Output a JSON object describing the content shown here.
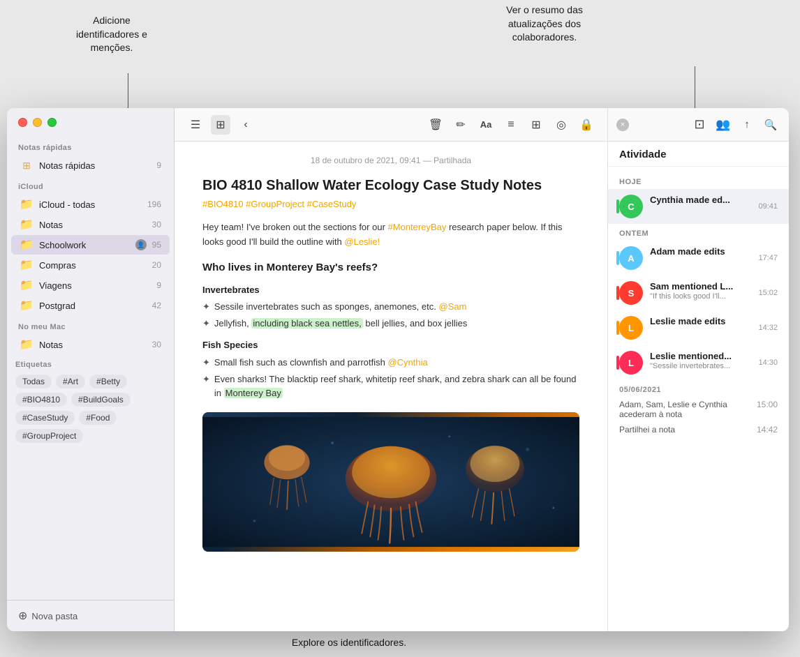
{
  "annotations": {
    "top_left": "Adicione\nidentificadores e\nmenções.",
    "top_right": "Ver o resumo das\natualizações dos\ncolaboradores.",
    "bottom_center": "Explore os identificadores."
  },
  "sidebar": {
    "sections": [
      {
        "label": "Notas rápidas",
        "items": [
          {
            "id": "quick-notes",
            "name": "Notas rápidas",
            "icon": "grid",
            "badge": "9"
          }
        ]
      },
      {
        "label": "iCloud",
        "items": [
          {
            "id": "icloud-all",
            "name": "iCloud - todas",
            "icon": "folder",
            "badge": "196"
          },
          {
            "id": "notas",
            "name": "Notas",
            "icon": "folder",
            "badge": "30"
          },
          {
            "id": "schoolwork",
            "name": "Schoolwork",
            "icon": "folder",
            "badge": "95",
            "active": true,
            "shared": true
          },
          {
            "id": "compras",
            "name": "Compras",
            "icon": "folder",
            "badge": "20"
          },
          {
            "id": "viagens",
            "name": "Viagens",
            "icon": "folder",
            "badge": "9"
          },
          {
            "id": "postgrad",
            "name": "Postgrad",
            "icon": "folder",
            "badge": "42"
          }
        ]
      },
      {
        "label": "No meu Mac",
        "items": [
          {
            "id": "notas-mac",
            "name": "Notas",
            "icon": "folder",
            "badge": "30"
          }
        ]
      }
    ],
    "tags": {
      "label": "Etiquetas",
      "items": [
        "Todas",
        "#Art",
        "#Betty",
        "#BIO4810",
        "#BuildGoals",
        "#CaseStudy",
        "#Food",
        "#GroupProject"
      ]
    },
    "footer": {
      "new_folder_label": "Nova pasta"
    }
  },
  "toolbar": {
    "icons": [
      "list",
      "grid",
      "back",
      "delete",
      "edit",
      "font",
      "list-format",
      "table",
      "media",
      "lock"
    ]
  },
  "note": {
    "meta": "18 de outubro de 2021, 09:41 — Partilhada",
    "title": "BIO 4810 Shallow Water Ecology Case Study Notes",
    "hashtags": "#BIO4810 #GroupProject #CaseStudy",
    "intro": "Hey team! I've broken out the sections for our #MontereyBay research paper below. If this looks good I'll build the outline with @Leslie!",
    "section1_heading": "Who lives in Monterey Bay's reefs?",
    "section2_heading": "Invertebrates",
    "invertebrates": [
      "Sessile invertebrates such as sponges, anemones, etc. @Sam",
      "Jellyfish, including black sea nettles, bell jellies, and box jellies"
    ],
    "section3_heading": "Fish Species",
    "fish": [
      "Small fish such as clownfish and parrotfish @Cynthia",
      "Even sharks! The blacktip reef shark, whitetip reef shark, and zebra shark can all be found in Monterey Bay"
    ]
  },
  "activity": {
    "panel_title": "Atividade",
    "close_btn": "×",
    "today_label": "HOJE",
    "yesterday_label": "ONTEM",
    "older_label": "05/06/2021",
    "items_today": [
      {
        "id": "cynthia-edit",
        "name": "Cynthia made ed...",
        "avatar_color": "#34c759",
        "avatar_initials": "C",
        "time": "09:41",
        "accent": "#34c759"
      }
    ],
    "items_yesterday": [
      {
        "id": "adam-edit",
        "name": "Adam made edits",
        "avatar_color": "#5ac8fa",
        "avatar_initials": "A",
        "time": "17:47",
        "accent": "#5ac8fa"
      },
      {
        "id": "sam-mention",
        "name": "Sam mentioned L...",
        "avatar_color": "#ff3b30",
        "avatar_initials": "S",
        "time": "15:02",
        "preview": "\"If this looks good I'll...",
        "accent": "#ff3b30"
      },
      {
        "id": "leslie-edit",
        "name": "Leslie made edits",
        "avatar_color": "#ff9500",
        "avatar_initials": "L",
        "time": "14:32",
        "accent": "#ff9500"
      },
      {
        "id": "leslie-mention",
        "name": "Leslie mentioned...",
        "avatar_color": "#ff2d55",
        "avatar_initials": "L",
        "time": "14:30",
        "preview": "\"Sessile invertebrates...",
        "accent": "#ff2d55"
      }
    ],
    "items_older": [
      {
        "id": "group-access",
        "text": "Adam, Sam, Leslie e Cynthia acederam à nota",
        "time": "15:00"
      },
      {
        "id": "shared",
        "text": "Partilhei a nota",
        "time": "14:42"
      }
    ]
  }
}
